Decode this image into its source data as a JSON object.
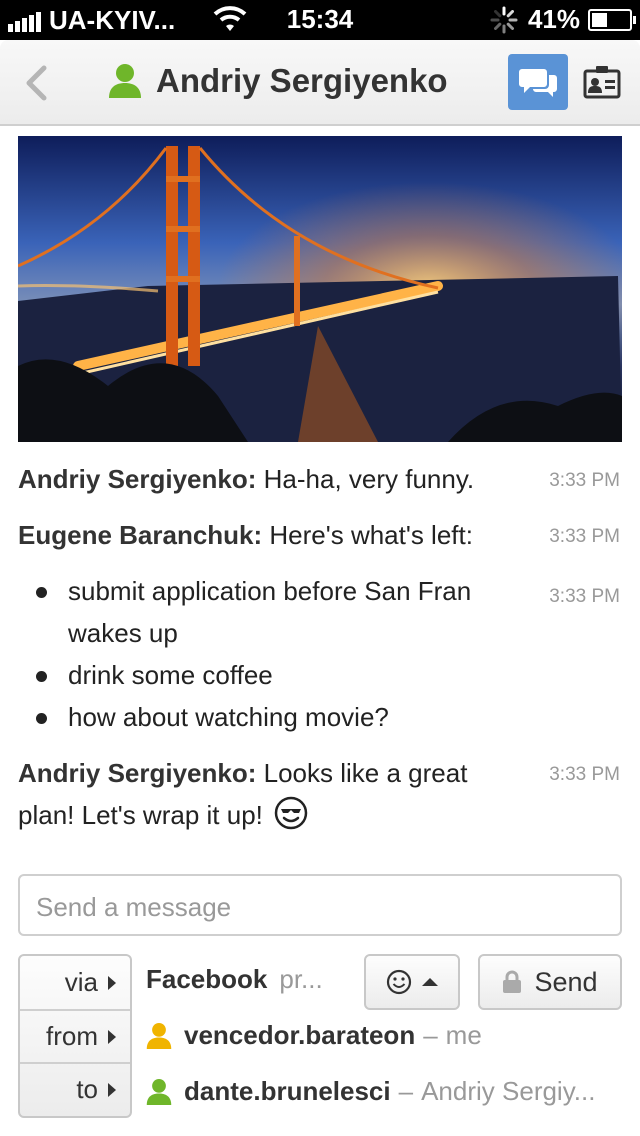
{
  "status": {
    "carrier": "UA-KYIV...",
    "time": "15:34",
    "battery": "41%",
    "battery_level": 0.41
  },
  "nav": {
    "title": "Andriy Sergiyenko",
    "accent": "#5a93d6"
  },
  "messages": [
    {
      "sender": "Andriy Sergiyenko:",
      "text": "Ha-ha, very funny.",
      "time": "3:33 PM"
    },
    {
      "sender": "Eugene Baranchuk:",
      "text": "Here's what's left:",
      "time": "3:33 PM"
    },
    {
      "sender": "Andriy Sergiyenko:",
      "text": "Looks like a great plan! Let's wrap it up!",
      "time": "3:33 PM"
    }
  ],
  "bullet_list": {
    "time": "3:33 PM",
    "items": [
      "submit application before San Fran wakes up",
      "drink some coffee",
      "how about watching movie?"
    ]
  },
  "composer": {
    "placeholder": "Send a message",
    "via_label": "via",
    "from_label": "from",
    "to_label": "to",
    "via_service": "Facebook",
    "via_extra": "pr...",
    "from_account": "vencedor.barateon",
    "from_note": "me",
    "to_account": "dante.brunelesci",
    "to_note": "Andriy Sergiy...",
    "send_label": "Send"
  }
}
